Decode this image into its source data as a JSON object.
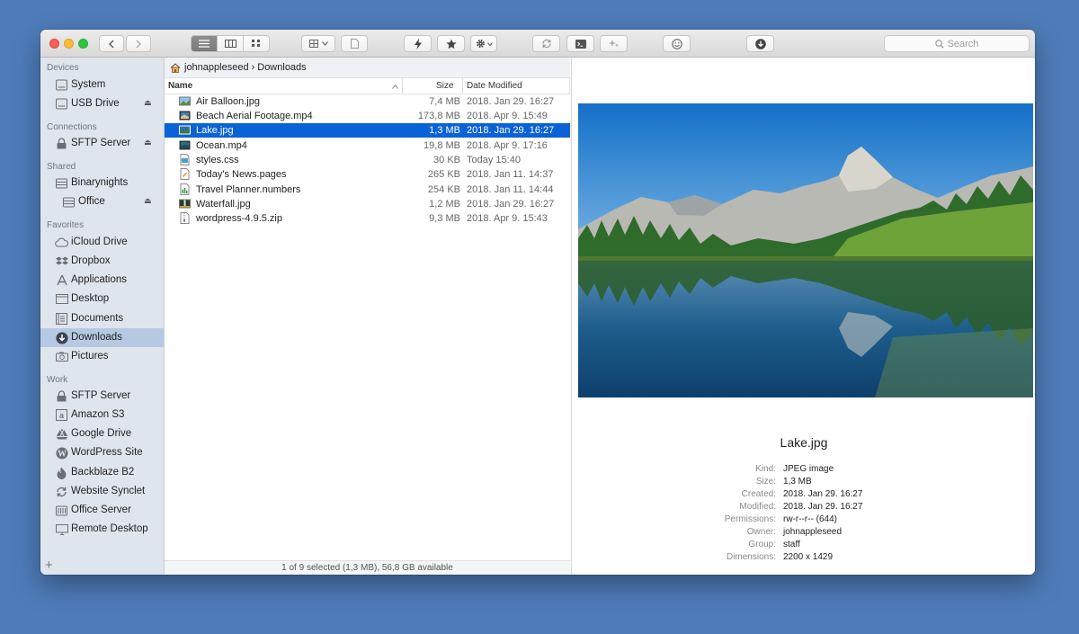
{
  "toolbar": {
    "search_placeholder": "Search",
    "icons": [
      "back-icon",
      "forward-icon",
      "list-view-icon",
      "column-view-icon",
      "icon-view-icon",
      "grid-menu-icon",
      "file-icon",
      "bolt-icon",
      "star-icon",
      "gear-icon",
      "sync-icon",
      "terminal-icon",
      "sparkle-icon",
      "smiley-icon",
      "download-icon"
    ]
  },
  "sidebar": {
    "sections": [
      {
        "title": "Devices",
        "items": [
          {
            "label": "System",
            "icon": "drive-icon"
          },
          {
            "label": "USB Drive",
            "icon": "drive-icon",
            "eject": "⏏"
          }
        ]
      },
      {
        "title": "Connections",
        "items": [
          {
            "label": "SFTP Server",
            "icon": "lock-icon",
            "eject": "⏏"
          }
        ]
      },
      {
        "title": "Shared",
        "items": [
          {
            "label": "Binarynights",
            "icon": "server-icon"
          },
          {
            "label": "Office",
            "icon": "server-icon",
            "eject": "⏏"
          }
        ]
      },
      {
        "title": "Favorites",
        "items": [
          {
            "label": "iCloud Drive",
            "icon": "cloud-icon"
          },
          {
            "label": "Dropbox",
            "icon": "dropbox-icon"
          },
          {
            "label": "Applications",
            "icon": "applications-icon"
          },
          {
            "label": "Desktop",
            "icon": "desktop-icon"
          },
          {
            "label": "Documents",
            "icon": "documents-icon"
          },
          {
            "label": "Downloads",
            "icon": "downloads-icon",
            "selected": true
          },
          {
            "label": "Pictures",
            "icon": "camera-icon"
          }
        ]
      },
      {
        "title": "Work",
        "items": [
          {
            "label": "SFTP Server",
            "icon": "lock-icon"
          },
          {
            "label": "Amazon S3",
            "icon": "s3-icon"
          },
          {
            "label": "Google Drive",
            "icon": "google-drive-icon"
          },
          {
            "label": "WordPress Site",
            "icon": "wordpress-icon"
          },
          {
            "label": "Backblaze B2",
            "icon": "flame-icon"
          },
          {
            "label": "Website Synclet",
            "icon": "sync-icon"
          },
          {
            "label": "Office Server",
            "icon": "server-icon"
          },
          {
            "label": "Remote Desktop",
            "icon": "monitor-icon"
          }
        ]
      }
    ],
    "add_label": "+"
  },
  "path": {
    "home": "johnappleseed",
    "separator": "›",
    "current": "Downloads"
  },
  "columns": {
    "name": "Name",
    "size": "Size",
    "date": "Date Modified"
  },
  "files": [
    {
      "name": "Air Balloon.jpg",
      "size": "7,4 MB",
      "date": "2018. Jan 29. 16:27",
      "icon": "image-icon"
    },
    {
      "name": "Beach Aerial Footage.mp4",
      "size": "173,8 MB",
      "date": "2018. Apr 9. 15:49",
      "icon": "video-icon"
    },
    {
      "name": "Lake.jpg",
      "size": "1,3 MB",
      "date": "2018. Jan 29. 16:27",
      "icon": "image-icon",
      "selected": true
    },
    {
      "name": "Ocean.mp4",
      "size": "19,8 MB",
      "date": "2018. Apr 9. 17:16",
      "icon": "video-icon"
    },
    {
      "name": "styles.css",
      "size": "30 KB",
      "date": "Today 15:40",
      "icon": "css-icon"
    },
    {
      "name": "Today's News.pages",
      "size": "265 KB",
      "date": "2018. Jan 11. 14:37",
      "icon": "pages-icon"
    },
    {
      "name": "Travel Planner.numbers",
      "size": "254 KB",
      "date": "2018. Jan 11. 14:44",
      "icon": "numbers-icon"
    },
    {
      "name": "Waterfall.jpg",
      "size": "1,2 MB",
      "date": "2018. Jan 29. 16:27",
      "icon": "image-icon"
    },
    {
      "name": "wordpress-4.9.5.zip",
      "size": "9,3 MB",
      "date": "2018. Apr 9. 15:43",
      "icon": "zip-icon"
    }
  ],
  "status": "1 of 9 selected (1,3 MB), 56,8 GB available",
  "preview": {
    "title": "Lake.jpg",
    "meta": [
      {
        "k": "Kind:",
        "v": "JPEG image"
      },
      {
        "k": "Size:",
        "v": "1,3 MB"
      },
      {
        "k": "Created:",
        "v": "2018. Jan 29. 16:27"
      },
      {
        "k": "Modified:",
        "v": "2018. Jan 29. 16:27"
      },
      {
        "k": "Permissions:",
        "v": "rw-r--r-- (644)"
      },
      {
        "k": "Owner:",
        "v": "johnappleseed"
      },
      {
        "k": "Group:",
        "v": "staff"
      },
      {
        "k": "Dimensions:",
        "v": "2200 x 1429"
      }
    ]
  },
  "colors": {
    "selection": "#0a63d6",
    "sidebar_selection": "#b7c9e2",
    "desktop": "#4e7cb9"
  }
}
